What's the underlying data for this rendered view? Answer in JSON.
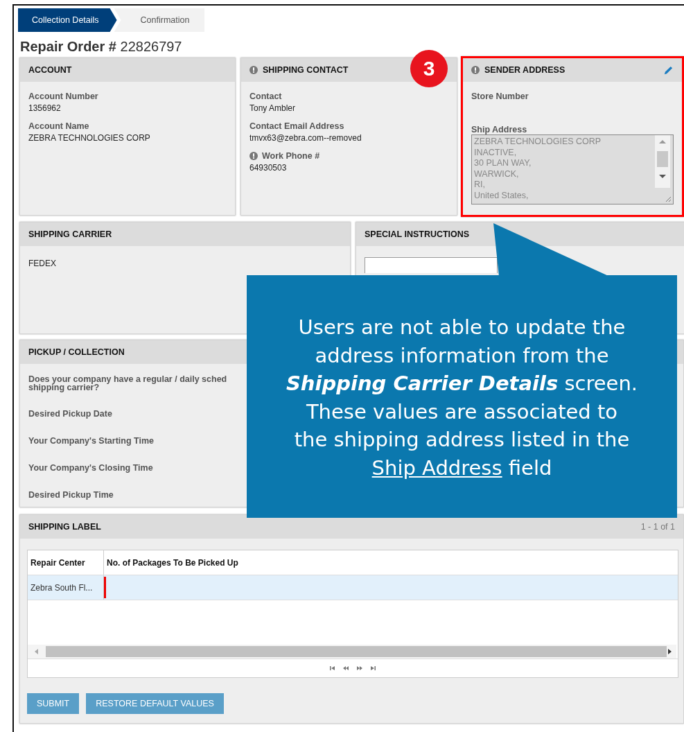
{
  "steps": [
    {
      "label": "Collection Details",
      "selected": true
    },
    {
      "label": "Confirmation",
      "selected": false
    }
  ],
  "title": {
    "label": "Repair Order #",
    "number": "22826797"
  },
  "account": {
    "heading": "ACCOUNT",
    "fields": [
      {
        "label": "Account Number",
        "value": "1356962"
      },
      {
        "label": "Account Name",
        "value": "ZEBRA TECHNOLOGIES CORP"
      }
    ]
  },
  "shipping_contact": {
    "heading": "SHIPPING CONTACT",
    "fields": [
      {
        "label": "Contact",
        "value": "Tony Ambler",
        "info": false
      },
      {
        "label": "Contact Email Address",
        "value": "tmvx63@zebra.com--removed",
        "info": false
      },
      {
        "label": "Work Phone #",
        "value": "64930503",
        "info": true
      }
    ]
  },
  "sender_address": {
    "heading": "SENDER ADDRESS",
    "highlighted": true,
    "store_number_label": "Store Number",
    "ship_address_label": "Ship Address",
    "ship_address_lines": [
      "ZEBRA TECHNOLOGIES CORP",
      "INACTIVE,",
      "30 PLAN WAY,",
      "WARWICK,",
      "RI,",
      "United States,"
    ]
  },
  "step_badge": "3",
  "shipping_carrier": {
    "heading": "SHIPPING CARRIER",
    "value": "FEDEX"
  },
  "special_instructions": {
    "heading": "SPECIAL INSTRUCTIONS"
  },
  "pickup": {
    "heading": "PICKUP / COLLECTION",
    "fields": [
      "Does your company have a regular / daily sched\nshipping carrier?",
      "Desired Pickup Date",
      "Your Company's Starting Time",
      "Your Company's Closing Time",
      "Desired Pickup Time"
    ]
  },
  "shipping_label": {
    "heading": "SHIPPING LABEL",
    "count": "1 - 1 of 1",
    "columns": [
      "Repair Center",
      "No. of Packages To Be Picked Up"
    ],
    "rows": [
      {
        "repair_center": "Zebra South Fl...",
        "selected": true,
        "editing": true
      }
    ]
  },
  "buttons": [
    "SUBMIT",
    "RESTORE DEFAULT VALUES"
  ],
  "callout": {
    "parts": [
      {
        "kind": "plain",
        "text": "Users are not able to update the\naddress information from the\n"
      },
      {
        "kind": "bold-italic",
        "text": "Shipping Carrier Details"
      },
      {
        "kind": "plain",
        "text": " screen.\nThese values are associated to\nthe shipping address listed in the\n"
      },
      {
        "kind": "link",
        "text": "Ship Address"
      },
      {
        "kind": "plain",
        "text": " field"
      }
    ]
  }
}
